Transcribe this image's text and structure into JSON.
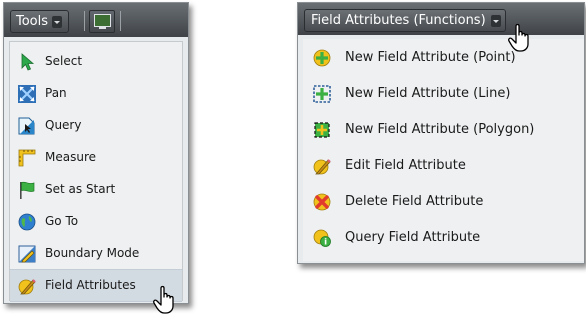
{
  "left_panel": {
    "toolbar": {
      "tools_label": "Tools"
    },
    "menu_items": [
      {
        "label": "Select",
        "icon": "select-arrow-icon"
      },
      {
        "label": "Pan",
        "icon": "pan-arrows-icon"
      },
      {
        "label": "Query",
        "icon": "query-icon"
      },
      {
        "label": "Measure",
        "icon": "measure-ruler-icon"
      },
      {
        "label": "Set as Start",
        "icon": "start-flag-icon"
      },
      {
        "label": "Go To",
        "icon": "globe-icon"
      },
      {
        "label": "Boundary Mode",
        "icon": "boundary-pencil-icon"
      },
      {
        "label": "Field Attributes",
        "icon": "field-attributes-icon"
      }
    ],
    "active_item": "Field Attributes"
  },
  "right_panel": {
    "toolbar": {
      "dropdown_label": "Field Attributes (Functions)"
    },
    "menu_items": [
      {
        "label": "New Field Attribute (Point)",
        "icon": "new-point-icon"
      },
      {
        "label": "New Field Attribute (Line)",
        "icon": "new-line-icon"
      },
      {
        "label": "New Field Attribute (Polygon)",
        "icon": "new-polygon-icon"
      },
      {
        "label": "Edit Field Attribute",
        "icon": "edit-pencil-icon"
      },
      {
        "label": "Delete Field Attribute",
        "icon": "delete-x-icon"
      },
      {
        "label": "Query Field Attribute",
        "icon": "query-info-icon"
      }
    ]
  },
  "colors": {
    "toolbar": "#4e5256",
    "menu_background": "#eef0f1",
    "active_row": "#d3dbe2"
  }
}
